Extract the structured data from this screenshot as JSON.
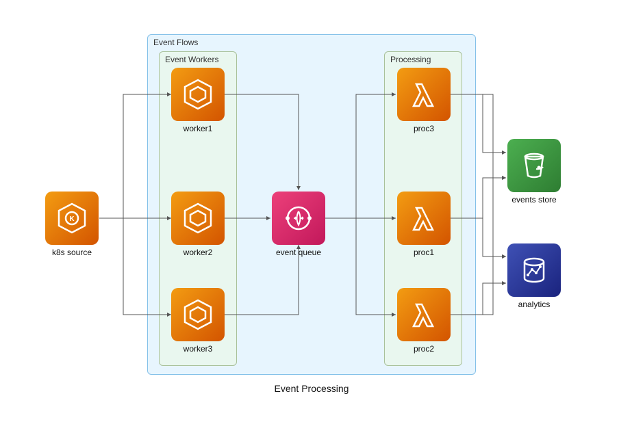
{
  "diagram_title": "Event Processing",
  "groups": {
    "event_flows": {
      "label": "Event Flows"
    },
    "event_workers": {
      "label": "Event Workers"
    },
    "processing": {
      "label": "Processing"
    }
  },
  "nodes": {
    "k8s_source": {
      "label": "k8s source",
      "icon": "eks-icon"
    },
    "worker1": {
      "label": "worker1",
      "icon": "ecs-icon"
    },
    "worker2": {
      "label": "worker2",
      "icon": "ecs-icon"
    },
    "worker3": {
      "label": "worker3",
      "icon": "ecs-icon"
    },
    "event_queue": {
      "label": "event queue",
      "icon": "eventbridge-icon"
    },
    "proc1": {
      "label": "proc1",
      "icon": "lambda-icon"
    },
    "proc2": {
      "label": "proc2",
      "icon": "lambda-icon"
    },
    "proc3": {
      "label": "proc3",
      "icon": "lambda-icon"
    },
    "events_store": {
      "label": "events store",
      "icon": "s3-icon"
    },
    "analytics": {
      "label": "analytics",
      "icon": "analytics-icon"
    }
  },
  "edges": [
    {
      "from": "k8s_source",
      "to": "worker1"
    },
    {
      "from": "k8s_source",
      "to": "worker2"
    },
    {
      "from": "k8s_source",
      "to": "worker3"
    },
    {
      "from": "worker1",
      "to": "event_queue"
    },
    {
      "from": "worker2",
      "to": "event_queue"
    },
    {
      "from": "worker3",
      "to": "event_queue"
    },
    {
      "from": "event_queue",
      "to": "proc1"
    },
    {
      "from": "event_queue",
      "to": "proc2"
    },
    {
      "from": "event_queue",
      "to": "proc3"
    },
    {
      "from": "proc1",
      "to": "events_store"
    },
    {
      "from": "proc2",
      "to": "events_store"
    },
    {
      "from": "proc3",
      "to": "events_store"
    },
    {
      "from": "proc1",
      "to": "analytics"
    },
    {
      "from": "proc2",
      "to": "analytics"
    },
    {
      "from": "proc3",
      "to": "analytics"
    }
  ]
}
